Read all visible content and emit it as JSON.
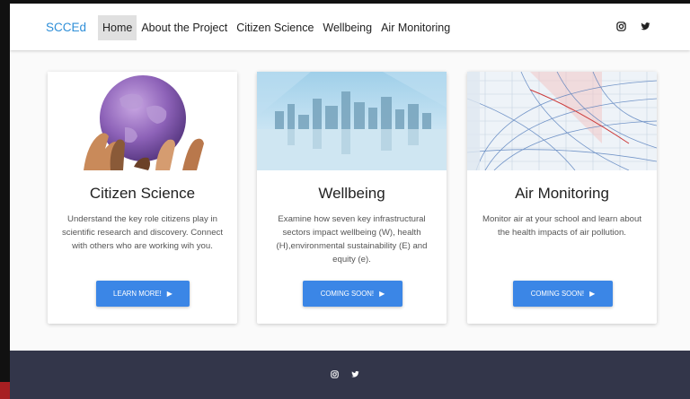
{
  "nav": {
    "brand": "SCCEd",
    "links": [
      "Home",
      "About the Project",
      "Citizen Science",
      "Wellbeing",
      "Air Monitoring"
    ],
    "icons": [
      "instagram-icon",
      "twitter-icon"
    ]
  },
  "cards": [
    {
      "title": "Citizen Science",
      "text": "Understand the key role citizens play in scientific research and discovery. Connect with others who are working wih you.",
      "button": "LEARN MORE!"
    },
    {
      "title": "Wellbeing",
      "text": "Examine how seven key infrastructural sectors impact wellbeing (W), health (H),environmental sustainability (E) and equity (e).",
      "button": "COMING SOON!"
    },
    {
      "title": "Air Monitoring",
      "text": "Monitor air at your school and learn about the health impacts of air pollution.",
      "button": "COMING SOON!"
    }
  ],
  "footer": {
    "icons": [
      "instagram-icon",
      "twitter-icon"
    ]
  },
  "colors": {
    "brand": "#2f8fd8",
    "button": "#3b86e6",
    "footer": "#33364a"
  }
}
